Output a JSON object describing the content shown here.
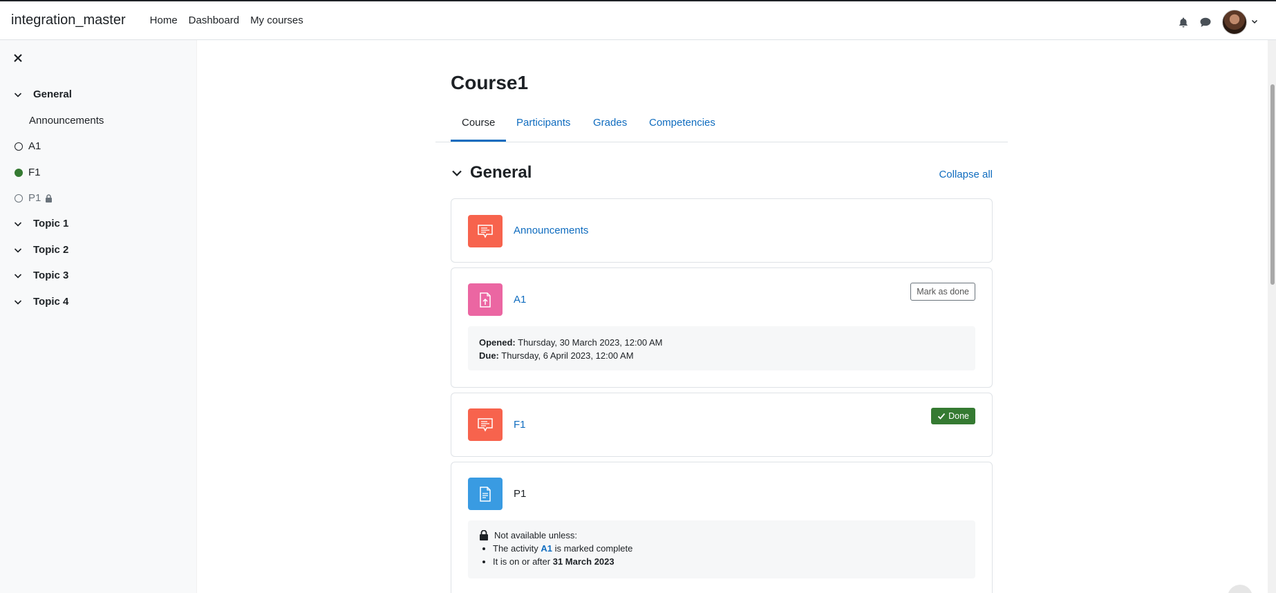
{
  "navbar": {
    "brand": "integration_master",
    "links": [
      "Home",
      "Dashboard",
      "My courses"
    ]
  },
  "drawer": {
    "items": [
      {
        "label": "General",
        "kind": "section"
      },
      {
        "label": "Announcements",
        "kind": "activity"
      },
      {
        "label": "A1",
        "kind": "activity",
        "completion": "incomplete"
      },
      {
        "label": "F1",
        "kind": "activity",
        "completion": "complete"
      },
      {
        "label": "P1",
        "kind": "activity",
        "completion": "locked"
      },
      {
        "label": "Topic 1",
        "kind": "section"
      },
      {
        "label": "Topic 2",
        "kind": "section"
      },
      {
        "label": "Topic 3",
        "kind": "section"
      },
      {
        "label": "Topic 4",
        "kind": "section"
      }
    ]
  },
  "page": {
    "title": "Course1",
    "tabs": [
      "Course",
      "Participants",
      "Grades",
      "Competencies"
    ]
  },
  "section": {
    "title": "General",
    "collapse_label": "Collapse all"
  },
  "activities": {
    "announcements": {
      "name": "Announcements",
      "color": "#f7634d"
    },
    "a1": {
      "name": "A1",
      "color": "#eb66a2",
      "button": "Mark as done",
      "opened_label": "Opened:",
      "opened_value": "Thursday, 30 March 2023, 12:00 AM",
      "due_label": "Due:",
      "due_value": "Thursday, 6 April 2023, 12:00 AM"
    },
    "f1": {
      "name": "F1",
      "color": "#f7634d",
      "button": "Done"
    },
    "p1": {
      "name": "P1",
      "color": "#399be2",
      "restriction_title": "Not available unless:",
      "restriction_1_pre": "The activity",
      "restriction_1_link": "A1",
      "restriction_1_post": "is marked complete",
      "restriction_2_pre": "It is on or after",
      "restriction_2_date": "31 March 2023"
    }
  },
  "colors": {
    "accent": "#0f6cbf",
    "success": "#357a32"
  }
}
